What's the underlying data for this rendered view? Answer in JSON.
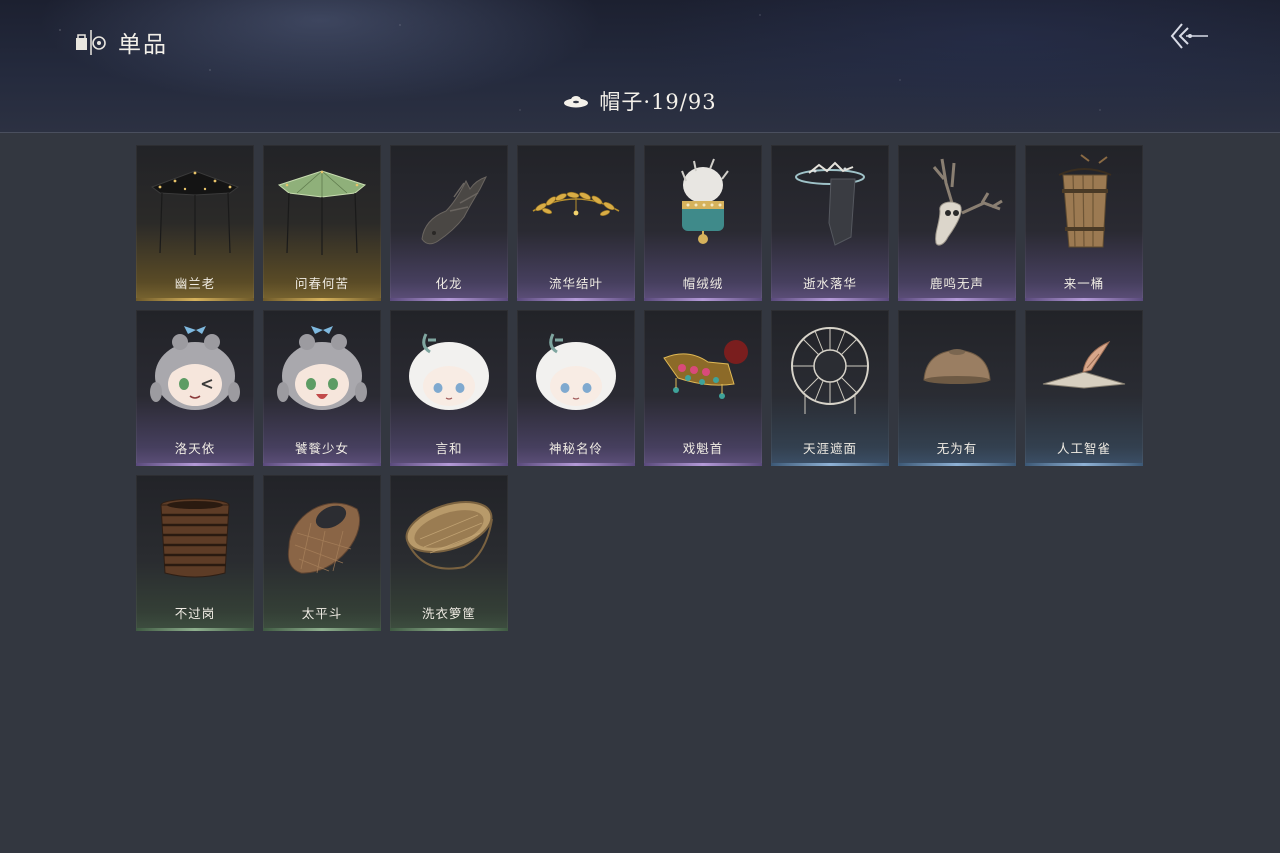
{
  "header": {
    "title": "单品",
    "category_name": "帽子",
    "category_count": "·19/93"
  },
  "colors": {
    "gold": "#d6b25c",
    "purple": "#b49ad8",
    "blue": "#8fb2d6",
    "green": "#8fb08f"
  },
  "items": [
    {
      "name": "幽兰老",
      "rarity": "gold",
      "icon": "black-bamboo-hat-icon"
    },
    {
      "name": "问春何苦",
      "rarity": "gold",
      "icon": "green-bamboo-hat-icon"
    },
    {
      "name": "化龙",
      "rarity": "purple",
      "icon": "dragon-head-icon"
    },
    {
      "name": "流华结叶",
      "rarity": "purple",
      "icon": "golden-laurel-icon"
    },
    {
      "name": "帽绒绒",
      "rarity": "purple",
      "icon": "fur-hat-icon"
    },
    {
      "name": "逝水落华",
      "rarity": "purple",
      "icon": "veil-hat-icon"
    },
    {
      "name": "鹿鸣无声",
      "rarity": "purple",
      "icon": "deer-skull-icon"
    },
    {
      "name": "来一桶",
      "rarity": "purple",
      "icon": "wooden-bucket-icon"
    },
    {
      "name": "洛天依",
      "rarity": "purple",
      "icon": "gray-hair-head-wink-icon"
    },
    {
      "name": "饕餮少女",
      "rarity": "purple",
      "icon": "gray-hair-head-icon"
    },
    {
      "name": "言和",
      "rarity": "purple",
      "icon": "white-hair-head-icon"
    },
    {
      "name": "神秘名伶",
      "rarity": "purple",
      "icon": "white-hair-head-icon"
    },
    {
      "name": "戏魁首",
      "rarity": "purple",
      "icon": "opera-crown-icon"
    },
    {
      "name": "天涯遮面",
      "rarity": "blue",
      "icon": "woven-frame-hat-icon"
    },
    {
      "name": "无为有",
      "rarity": "blue",
      "icon": "clay-bowl-icon"
    },
    {
      "name": "人工智雀",
      "rarity": "blue",
      "icon": "bird-hat-icon"
    },
    {
      "name": "不过岗",
      "rarity": "green",
      "icon": "stacked-bowls-icon"
    },
    {
      "name": "太平斗",
      "rarity": "green",
      "icon": "bamboo-basket-icon"
    },
    {
      "name": "洗衣箩筐",
      "rarity": "green",
      "icon": "wicker-basket-icon"
    }
  ]
}
